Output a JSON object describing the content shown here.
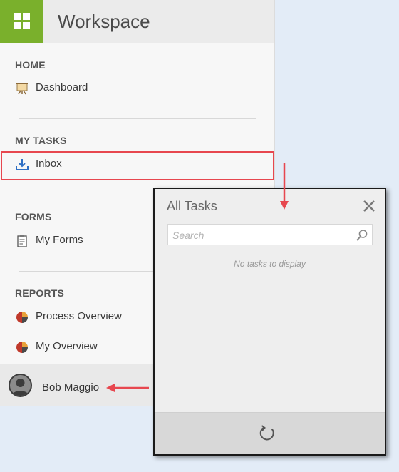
{
  "header": {
    "title": "Workspace"
  },
  "sections": {
    "home": {
      "label": "HOME",
      "items": [
        {
          "label": "Dashboard",
          "icon": "easel-icon"
        }
      ]
    },
    "my_tasks": {
      "label": "MY TASKS",
      "items": [
        {
          "label": "Inbox",
          "icon": "inbox-download-icon"
        }
      ]
    },
    "forms": {
      "label": "FORMS",
      "items": [
        {
          "label": "My Forms",
          "icon": "form-icon"
        }
      ]
    },
    "reports": {
      "label": "REPORTS",
      "items": [
        {
          "label": "Process Overview",
          "icon": "pie-chart-icon"
        },
        {
          "label": "My Overview",
          "icon": "pie-chart-icon"
        }
      ]
    }
  },
  "user": {
    "name": "Bob Maggio"
  },
  "tasks_panel": {
    "title": "All Tasks",
    "search_placeholder": "Search",
    "empty_message": "No tasks to display"
  },
  "colors": {
    "accent_green": "#7ab02c",
    "highlight_red": "#e7474f",
    "inbox_blue": "#2f6fc4"
  }
}
